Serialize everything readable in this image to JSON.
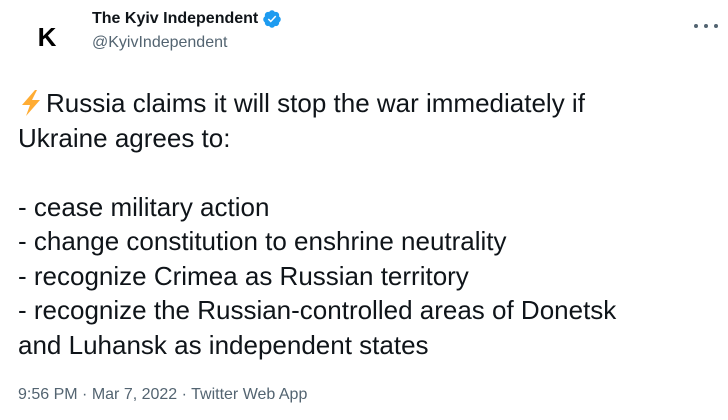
{
  "tweet": {
    "author": {
      "avatar_letter": "K",
      "display_name": "The Kyiv Independent",
      "handle": "@KyivIndependent",
      "verified": true
    },
    "body": {
      "emoji": "lightning-bolt",
      "lines": [
        "Russia claims it will stop the war immediately if",
        "Ukraine agrees to:",
        "",
        "- cease military action",
        "- change constitution to enshrine neutrality",
        "- recognize Crimea as Russian territory",
        "- recognize the Russian-controlled areas of Donetsk",
        "and Luhansk as independent states"
      ]
    },
    "meta": {
      "time": "9:56 PM",
      "separator": " · ",
      "date": "Mar 7, 2022",
      "source": "Twitter Web App"
    },
    "colors": {
      "text": "#0f1419",
      "secondary": "#536471",
      "verified": "#1d9bf0",
      "bolt": "#ffac33"
    },
    "icons": {
      "verified": "verified-badge-icon",
      "more": "more-options-icon",
      "emoji": "lightning-bolt-icon"
    }
  }
}
